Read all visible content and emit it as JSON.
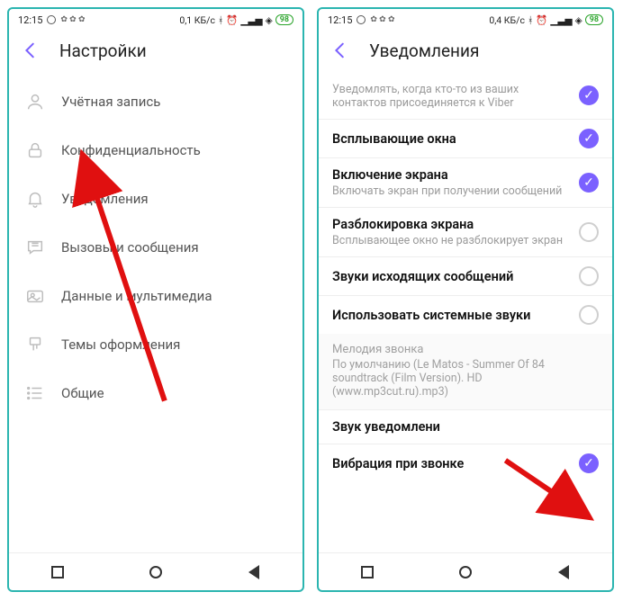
{
  "left": {
    "statusbar": {
      "time": "12:15",
      "data": "0,1 КБ/с",
      "battery": "98"
    },
    "title": "Настройки",
    "menu": [
      {
        "label": "Учётная запись",
        "icon": "user"
      },
      {
        "label": "Конфиденциальность",
        "icon": "lock"
      },
      {
        "label": "Уведомления",
        "icon": "bell"
      },
      {
        "label": "Вызовы и сообщения",
        "icon": "chat"
      },
      {
        "label": "Данные и мультимедиа",
        "icon": "photo"
      },
      {
        "label": "Темы оформления",
        "icon": "brush"
      },
      {
        "label": "Общие",
        "icon": "list"
      }
    ]
  },
  "right": {
    "statusbar": {
      "time": "12:15",
      "data": "0,4 КБ/с",
      "battery": "98"
    },
    "title": "Уведомления",
    "rows": [
      {
        "title": "",
        "sub": "Уведомлять, когда кто-то из ваших контактов присоединяется к Viber",
        "on": true
      },
      {
        "title": "Всплывающие окна",
        "sub": "",
        "on": true
      },
      {
        "title": "Включение экрана",
        "sub": "Включать экран при получении сообщений",
        "on": true
      },
      {
        "title": "Разблокировка экрана",
        "sub": "Всплывающее окно не разблокирует экран",
        "on": false
      },
      {
        "title": "Звуки исходящих сообщений",
        "sub": "",
        "on": false
      },
      {
        "title": "Использовать системные звуки",
        "sub": "",
        "on": false
      }
    ],
    "ringtone": {
      "caption": "Мелодия звонка",
      "value": "По умолчанию (Le Matos - Summer Of 84 soundtrack (Film Version). HD (www.mp3cut.ru).mp3)"
    },
    "rows2": [
      {
        "title": "Звук уведомлени",
        "sub": "",
        "on": null
      },
      {
        "title": "Вибрация при звонке",
        "sub": "",
        "on": true
      }
    ]
  }
}
